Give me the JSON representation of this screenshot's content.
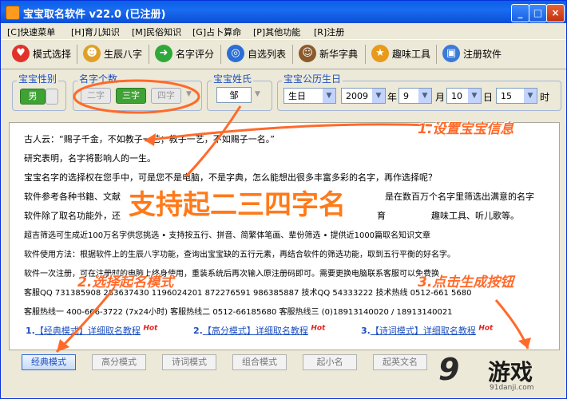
{
  "window": {
    "title": "宝宝取名软件 v22.0 (已注册)",
    "minimize": "_",
    "maximize": "□",
    "close": "×"
  },
  "menu": [
    {
      "label": "[C]快速菜单"
    },
    {
      "label": "[H]育儿知识"
    },
    {
      "label": "[M]民俗知识"
    },
    {
      "label": "[G]占卜算命"
    },
    {
      "label": "[P]其他功能"
    },
    {
      "label": "[R]注册"
    }
  ],
  "toolbar": [
    {
      "label": "模式选择",
      "icon": "heart-icon",
      "color": "#e0322a"
    },
    {
      "label": "生辰八字",
      "icon": "people-icon",
      "color": "#e0a028"
    },
    {
      "label": "名字评分",
      "icon": "arrow-right-icon",
      "color": "#2fa83a"
    },
    {
      "label": "自选列表",
      "icon": "globe-icon",
      "color": "#2b6fd6"
    },
    {
      "label": "新华字典",
      "icon": "person-icon",
      "color": "#8a5a2b"
    },
    {
      "label": "趣味工具",
      "icon": "star-icon",
      "color": "#e89a1a"
    },
    {
      "label": "注册软件",
      "icon": "computer-icon",
      "color": "#3a7ad8"
    }
  ],
  "form": {
    "gender_label": "宝宝性别",
    "gender_value": "男",
    "count_label": "名字个数",
    "count_options": [
      "二字",
      "三字",
      "四字"
    ],
    "count_selected": "三字",
    "surname_label": "宝宝姓氏",
    "surname_value": "邹",
    "birth_label": "宝宝公历生日",
    "birth_type": "生日",
    "year": "2009",
    "year_unit": "年",
    "month": "9",
    "month_unit": "月",
    "day": "10",
    "day_unit": "日",
    "hour": "15",
    "hour_unit": "时"
  },
  "content": {
    "lines": [
      "古人云：“赐子千金，不如教子一艺；教子一艺，不如赐子一名。”",
      "研究表明，名字将影响人的一生。",
      "宝宝名字的选择权在您手中，可是您不是电脑，不是字典，怎么能想出很多丰富多彩的名字，再作选择呢？",
      "软件参考各种书籍、文献",
      "软件除了取名功能外，还",
      "超吉筛选可生成近100万名字供您挑选  • 支持按五行、拼音、简繁体笔画、辈份筛选  • 提供近1000篇取名知识文章",
      "软件使用方法：根据软件上的生辰八字功能，查询出宝宝缺的五行元素，再结合软件的筛选功能，取到五行平衡的好名字。",
      "软件一次注册，可在注册时的电脑上终身使用，重装系统后再次输入原注册码即可。需要更换电脑联系客服可以免费换",
      "客服QQ  731385908   283637430   1196024201   872276591   986385887   技术QQ  54333222   技术热线  0512-661 5680",
      "客服热线一  400-666-3722 (7x24小时)    客服热线二  0512-66185680    客服热线三  (0)18913140020 / 18913140021"
    ],
    "extra_right_3": "是在数百万个名字里筛选出满意的名字",
    "extra_right_4": "趣味工具、听儿歌等。",
    "extra_mid_4": "育"
  },
  "tutorials": [
    {
      "num": "1.",
      "link": "【经典模式】详细取名教程",
      "hot": "Hot"
    },
    {
      "num": "2.",
      "link": "【高分模式】详细取名教程",
      "hot": "Hot"
    },
    {
      "num": "3.",
      "link": "【诗词模式】详细取名教程",
      "hot": "Hot"
    }
  ],
  "mode_tabs": [
    {
      "label": "经典模式",
      "active": true
    },
    {
      "label": "高分模式",
      "active": false
    },
    {
      "label": "诗词模式",
      "active": false
    },
    {
      "label": "组合模式",
      "active": false
    },
    {
      "label": "起小名",
      "active": false
    },
    {
      "label": "起英文名",
      "active": false
    }
  ],
  "annotations": {
    "big": "支持起二三四字名",
    "a1": "1.设置宝宝信息",
    "a2": "2.选择起名模式",
    "a3": "3.点击生成按钮",
    "accent": "#ff6a2a"
  },
  "watermark": {
    "mark": "9",
    "name": "游戏",
    "url": "91danji.com"
  }
}
